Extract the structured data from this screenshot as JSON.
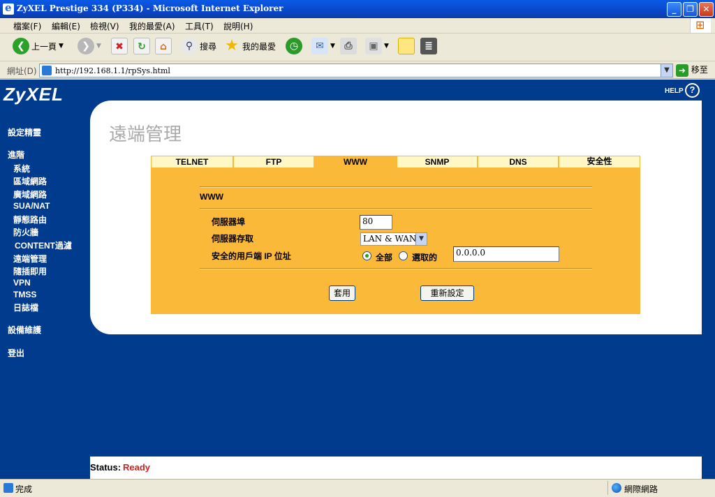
{
  "window": {
    "title": "ZyXEL Prestige 334 (P334) - Microsoft Internet Explorer",
    "minimize": "_",
    "maximize": "❐",
    "close": "✕"
  },
  "menu": [
    "檔案(F)",
    "編輯(E)",
    "檢視(V)",
    "我的最愛(A)",
    "工具(T)",
    "說明(H)"
  ],
  "toolbar": {
    "back_label": "上一頁",
    "search_label": "搜尋",
    "favorites_label": "我的最愛"
  },
  "address": {
    "label": "網址(D)",
    "url": "http://192.168.1.1/rpSys.html",
    "go_label": "移至"
  },
  "brand": {
    "logo": "ZyXEL",
    "help_label": "HELP",
    "help_icon": "?"
  },
  "sidebar": {
    "wizard": "設定精靈",
    "advanced": "進階",
    "items": [
      "系統",
      "區域網路",
      "廣域網路",
      "SUA/NAT",
      "靜態路由",
      "防火牆",
      "CONTENT過濾",
      "遠端管理",
      "隨插即用",
      "VPN",
      "TMSS",
      "日誌檔"
    ],
    "maintenance": "設備維護",
    "logout": "登出"
  },
  "page": {
    "title": "遠端管理",
    "tabs": [
      "TELNET",
      "FTP",
      "WWW",
      "SNMP",
      "DNS",
      "安全性"
    ],
    "active_tab": "WWW",
    "section": "WWW",
    "server_port_label": "伺服器埠",
    "server_port_value": "80",
    "server_access_label": "伺服器存取",
    "server_access_value": "LAN & WAN",
    "secure_ip_label": "安全的用戶端 IP 位址",
    "radio_all": "全部",
    "radio_selected": "選取的",
    "radio_all_checked": true,
    "ip_value": "0.0.0.0",
    "apply_button": "套用",
    "reset_button": "重新設定"
  },
  "status": {
    "label": "Status:",
    "value": "Ready"
  },
  "statusbar": {
    "text": "完成",
    "zone": "網際網路"
  }
}
